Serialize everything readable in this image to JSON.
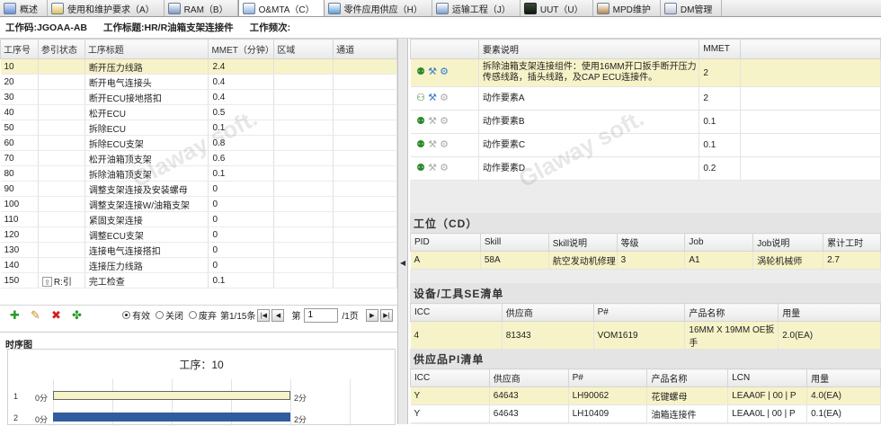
{
  "tabs": [
    {
      "label": "概述",
      "icon": "overview-icon",
      "cls": "t1"
    },
    {
      "label": "使用和维护要求（A）",
      "icon": "requirements-icon",
      "cls": "t2"
    },
    {
      "label": "RAM（B）",
      "icon": "ram-icon",
      "cls": "t3"
    },
    {
      "label": "O&MTA（C）",
      "icon": "omta-icon",
      "cls": "t4"
    },
    {
      "label": "零件应用供应（H）",
      "icon": "parts-supply-icon",
      "cls": "t5"
    },
    {
      "label": "运输工程（J）",
      "icon": "transport-icon",
      "cls": "t6"
    },
    {
      "label": "UUT（U）",
      "icon": "uut-icon",
      "cls": "t7"
    },
    {
      "label": "MPD维护",
      "icon": "mpd-icon",
      "cls": "t8"
    },
    {
      "label": "DM管理",
      "icon": "dm-icon",
      "cls": "t9"
    }
  ],
  "active_tab": 3,
  "info": {
    "work_code": "工作码:JGOAA-AB",
    "work_title": "工作标题:HR/R油箱支架连接件",
    "work_freq": "工作频次:"
  },
  "operations": {
    "headers": [
      "工序号",
      "参引状态",
      "工序标题",
      "MMET（分钟）",
      "区域",
      "通道"
    ],
    "rows": [
      {
        "no": "10",
        "ref": "",
        "title": "断开压力线路",
        "mmet": "2.4"
      },
      {
        "no": "20",
        "ref": "",
        "title": "断开电气连接头",
        "mmet": "0.4"
      },
      {
        "no": "30",
        "ref": "",
        "title": "断开ECU接地搭扣",
        "mmet": "0.4"
      },
      {
        "no": "40",
        "ref": "",
        "title": "松开ECU",
        "mmet": "0.5"
      },
      {
        "no": "50",
        "ref": "",
        "title": "拆除ECU",
        "mmet": "0.1"
      },
      {
        "no": "60",
        "ref": "",
        "title": "拆除ECU支架",
        "mmet": "0.8"
      },
      {
        "no": "70",
        "ref": "",
        "title": "松开油箱顶支架",
        "mmet": "0.6"
      },
      {
        "no": "80",
        "ref": "",
        "title": "拆除油箱顶支架",
        "mmet": "0.1"
      },
      {
        "no": "90",
        "ref": "",
        "title": "调整支架连接及安装螺母",
        "mmet": "0"
      },
      {
        "no": "100",
        "ref": "",
        "title": "调整支架连接W/油箱支架",
        "mmet": "0"
      },
      {
        "no": "110",
        "ref": "",
        "title": "紧固支架连接",
        "mmet": "0"
      },
      {
        "no": "120",
        "ref": "",
        "title": "调整ECU支架",
        "mmet": "0"
      },
      {
        "no": "130",
        "ref": "",
        "title": "连接电气连接搭扣",
        "mmet": "0"
      },
      {
        "no": "140",
        "ref": "",
        "title": "连接压力线路",
        "mmet": "0"
      },
      {
        "no": "150",
        "ref": "R:引",
        "title": "完工检查",
        "mmet": "0.1"
      }
    ]
  },
  "pager": {
    "radio_valid": "有效",
    "radio_closed": "关闭",
    "radio_void": "废弃",
    "page_info": "第1/15条",
    "page_label": "第",
    "page_value": "1",
    "page_total": "/1页"
  },
  "timeline": {
    "title": "时序图",
    "op_label": "工序：10",
    "row1": "1",
    "row2": "2",
    "start1": "0分",
    "end1": "2分",
    "start2": "0分",
    "end2": "2分"
  },
  "elements": {
    "headers": [
      "",
      "要素说明",
      "MMET"
    ],
    "rows": [
      {
        "desc": "拆除油箱支架连接组件：使用16MM开口扳手断开压力传感线路，插头线路，及CAP ECU连接件。",
        "mmet": "2",
        "icon": "person-icon"
      },
      {
        "desc": "动作要素A",
        "mmet": "2",
        "icon": "person-pair-icon"
      },
      {
        "desc": "动作要素B",
        "mmet": "0.1",
        "icon": "person-icon"
      },
      {
        "desc": "动作要素C",
        "mmet": "0.1",
        "icon": "person-icon"
      },
      {
        "desc": "动作要素D",
        "mmet": "0.2",
        "icon": "person-icon"
      }
    ]
  },
  "workstation": {
    "title": "工位（CD）",
    "headers": [
      "PID",
      "Skill",
      "Skill说明",
      "等级",
      "Job",
      "Job说明",
      "累计工时"
    ],
    "rows": [
      [
        "A",
        "58A",
        "航空发动机修理",
        "3",
        "A1",
        "涡轮机械师",
        "2.7"
      ]
    ]
  },
  "equipment": {
    "title": "设备/工具SE清单",
    "headers": [
      "ICC",
      "供应商",
      "P#",
      "产品名称",
      "用量"
    ],
    "rows": [
      [
        "4",
        "81343",
        "VOM1619",
        "16MM X 19MM OE扳手",
        "2.0(EA)"
      ]
    ]
  },
  "supplies": {
    "title": "供应品PI清单",
    "headers": [
      "ICC",
      "供应商",
      "P#",
      "产品名称",
      "LCN",
      "用量"
    ],
    "rows": [
      [
        "Y",
        "64643",
        "LH90062",
        "花键螺母",
        "LEAA0F | 00 | P",
        "4.0(EA)"
      ],
      [
        "Y",
        "64643",
        "LH10409",
        "油箱连接件",
        "LEAA0L | 00 | P",
        "0.1(EA)"
      ]
    ]
  },
  "watermark": "Glaway soft."
}
